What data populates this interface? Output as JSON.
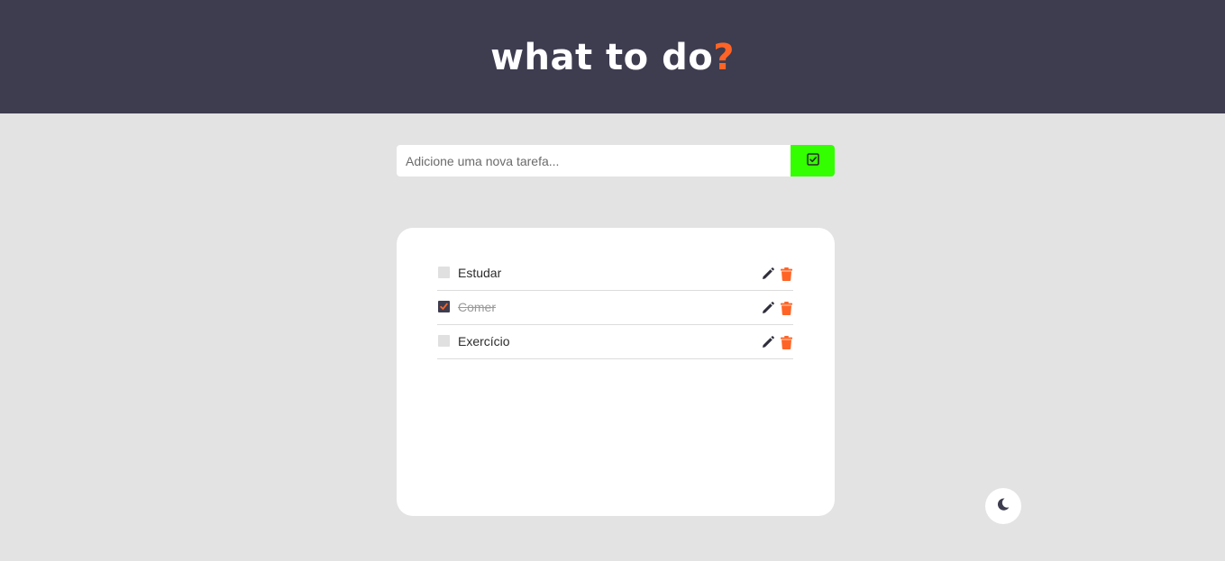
{
  "header": {
    "title_light": "what to ",
    "title_bold": "do",
    "title_mark": "?"
  },
  "add_form": {
    "placeholder": "Adicione uma nova tarefa...",
    "value": "",
    "button_icon": "check-square-icon"
  },
  "tasks": [
    {
      "label": "Estudar",
      "checked": false
    },
    {
      "label": "Comer",
      "checked": true
    },
    {
      "label": "Exercício",
      "checked": false
    }
  ],
  "icons": {
    "edit": "pencil-icon",
    "delete": "trash-icon",
    "theme": "moon-icon"
  },
  "colors": {
    "header_bg": "#3e3c4f",
    "page_bg": "#e3e3e3",
    "accent": "#ff6426",
    "add_button": "#33ff00",
    "card_bg": "#ffffff"
  }
}
